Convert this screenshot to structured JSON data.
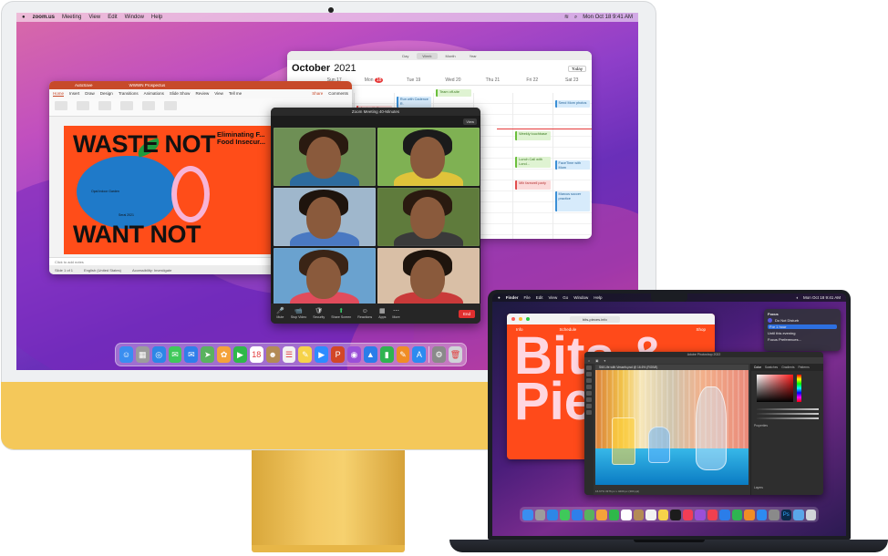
{
  "imac": {
    "menubar": {
      "app": "zoom.us",
      "items": [
        "Meeting",
        "View",
        "Edit",
        "Window",
        "Help"
      ],
      "clock": "Mon Oct 18  9:41 AM"
    },
    "calendar": {
      "tabs": [
        "Day",
        "Week",
        "Month",
        "Year"
      ],
      "selected_tab": "Week",
      "month": "October",
      "year": "2021",
      "today_button": "Today",
      "days": [
        {
          "name": "Sun",
          "num": "17"
        },
        {
          "name": "Mon",
          "num": "18"
        },
        {
          "name": "Tue",
          "num": "19"
        },
        {
          "name": "Wed",
          "num": "20"
        },
        {
          "name": "Thu",
          "num": "21"
        },
        {
          "name": "Fri",
          "num": "22"
        },
        {
          "name": "Sat",
          "num": "23"
        }
      ],
      "events": [
        {
          "text": "Appt. with Dr. Evans"
        },
        {
          "text": "Run with Cadence R."
        },
        {
          "text": "Team off-site"
        },
        {
          "text": "Breakfast + retro"
        },
        {
          "text": "Weekly touchbase"
        },
        {
          "text": "Send Mom photos"
        },
        {
          "text": "Lunch Call with Lond..."
        },
        {
          "text": "FaceTime with Mom"
        },
        {
          "text": "Mih farewell party"
        },
        {
          "text": "Marcus soccer practice"
        }
      ]
    },
    "powerpoint": {
      "autosave": "AutoSave",
      "filename": "WWWN Prospectus",
      "tabs": [
        "Home",
        "Insert",
        "Draw",
        "Design",
        "Transitions",
        "Animations",
        "Slide Show",
        "Review",
        "View",
        "Tell me"
      ],
      "share": "Share",
      "comments": "Comments",
      "slide": {
        "line1": "WASTE NOT",
        "line2": "WANT NOT",
        "heading": "Eliminating F... Food Insecur...",
        "blob_label": "Opal Indoor Garden",
        "blob_label2": "Serai 2021"
      },
      "notes": "Click to add notes",
      "status_slide": "Slide 1 of 1",
      "status_lang": "English (United States)",
      "status_access": "Accessibility: Investigate",
      "status_notes": "Notes",
      "status_comments": "Comments"
    },
    "zoom": {
      "title": "Zoom Meeting  40-Minutes",
      "view_button": "View",
      "tiles": [
        {
          "bg": "#6e8f55",
          "shirt": "#2d6b9e",
          "hair": "#2a1a10"
        },
        {
          "bg": "#7fb153",
          "shirt": "#e0c33a",
          "hair": "#1b1b1b"
        },
        {
          "bg": "#9fb7cc",
          "shirt": "#4a79c2",
          "hair": "#1e140d"
        },
        {
          "bg": "#5f7b3c",
          "shirt": "#3a3a3a",
          "hair": "#2a1a10"
        },
        {
          "bg": "#6aa2cf",
          "shirt": "#e14c5c",
          "hair": "#3a2416"
        },
        {
          "bg": "#d9bfa6",
          "shirt": "#c93a3a",
          "hair": "#1e140d"
        }
      ],
      "toolbar": [
        {
          "icon": "🎤",
          "label": "Mute"
        },
        {
          "icon": "📹",
          "label": "Stop Video"
        },
        {
          "icon": "🛡",
          "label": "Security"
        },
        {
          "icon": "⬆",
          "label": "Share Screen"
        },
        {
          "icon": "☺",
          "label": "Reactions"
        },
        {
          "icon": "▦",
          "label": "Apps"
        },
        {
          "icon": "⋯",
          "label": "More"
        }
      ],
      "end": "End"
    },
    "dock": [
      {
        "name": "finder",
        "color": "#3a8ef0",
        "glyph": "☺"
      },
      {
        "name": "launchpad",
        "color": "#9c9c9c",
        "glyph": "▦"
      },
      {
        "name": "safari",
        "color": "#2d87e6",
        "glyph": "◎"
      },
      {
        "name": "messages",
        "color": "#3fc95a",
        "glyph": "✉"
      },
      {
        "name": "mail",
        "color": "#2f7fea",
        "glyph": "✉"
      },
      {
        "name": "maps",
        "color": "#59b25f",
        "glyph": "➤"
      },
      {
        "name": "photos",
        "color": "#f4a23a",
        "glyph": "✿"
      },
      {
        "name": "facetime",
        "color": "#2fb84a",
        "glyph": "▶"
      },
      {
        "name": "calendar",
        "color": "#ffffff",
        "glyph": "18"
      },
      {
        "name": "contacts",
        "color": "#b38b55",
        "glyph": "☻"
      },
      {
        "name": "reminders",
        "color": "#f2f2f2",
        "glyph": "☰"
      },
      {
        "name": "notes",
        "color": "#f6d34a",
        "glyph": "✎"
      },
      {
        "name": "zoom",
        "color": "#2d8cff",
        "glyph": "▶"
      },
      {
        "name": "powerpoint",
        "color": "#d24726",
        "glyph": "P"
      },
      {
        "name": "podcasts",
        "color": "#9a4fd8",
        "glyph": "◉"
      },
      {
        "name": "keynote",
        "color": "#2b7de9",
        "glyph": "▲"
      },
      {
        "name": "numbers",
        "color": "#2fb451",
        "glyph": "▮"
      },
      {
        "name": "pages",
        "color": "#f08d25",
        "glyph": "✎"
      },
      {
        "name": "app-store",
        "color": "#2d8bf0",
        "glyph": "A"
      },
      {
        "name": "system-preferences",
        "color": "#8a8a8a",
        "glyph": "⚙"
      },
      {
        "name": "trash",
        "color": "#d0d4d8",
        "glyph": "🗑"
      }
    ]
  },
  "macbook": {
    "menubar": {
      "app": "Finder",
      "items": [
        "File",
        "Edit",
        "View",
        "Go",
        "Window",
        "Help"
      ],
      "clock": "Mon Oct 18  9:41 AM"
    },
    "safari": {
      "url": "bits-pieces.info",
      "nav_left": "Info",
      "nav_mid": "Schedule",
      "nav_right": "Shop",
      "big_text": "Bits & Pie"
    },
    "focus": {
      "title": "Focus",
      "subtitle": "Do Not Disturb",
      "options": [
        "For 1 hour",
        "Until this evening"
      ],
      "footer": "Focus Preferences..."
    },
    "photoshop": {
      "title": "Adobe Photoshop 2022",
      "doc_tab": "Still Life with Vessels.psd @ 16.6% (RGB/8)",
      "panel_tabs": [
        "Color",
        "Swatches",
        "Gradients",
        "Patterns"
      ],
      "properties": "Properties",
      "layers": "Layers",
      "status": "16.67%   3376 px x 4200 px (300 ppi)"
    },
    "dock": [
      {
        "name": "finder",
        "color": "#3a8ef0"
      },
      {
        "name": "launchpad",
        "color": "#9c9c9c"
      },
      {
        "name": "safari",
        "color": "#2d87e6"
      },
      {
        "name": "messages",
        "color": "#3fc95a"
      },
      {
        "name": "mail",
        "color": "#2f7fea"
      },
      {
        "name": "maps",
        "color": "#59b25f"
      },
      {
        "name": "photos",
        "color": "#f4a23a"
      },
      {
        "name": "facetime",
        "color": "#2fb84a"
      },
      {
        "name": "calendar",
        "color": "#ffffff"
      },
      {
        "name": "contacts",
        "color": "#b38b55"
      },
      {
        "name": "reminders",
        "color": "#f2f2f2"
      },
      {
        "name": "notes",
        "color": "#f6d34a"
      },
      {
        "name": "tv",
        "color": "#1c1c1c"
      },
      {
        "name": "music",
        "color": "#f23d56"
      },
      {
        "name": "podcasts",
        "color": "#9a4fd8"
      },
      {
        "name": "news",
        "color": "#f0404f"
      },
      {
        "name": "keynote",
        "color": "#2b7de9"
      },
      {
        "name": "numbers",
        "color": "#2fb451"
      },
      {
        "name": "pages",
        "color": "#f08d25"
      },
      {
        "name": "app-store",
        "color": "#2d8bf0"
      },
      {
        "name": "system-preferences",
        "color": "#8a8a8a"
      },
      {
        "name": "photoshop",
        "color": "#0b2a4a",
        "glyph": "Ps"
      },
      {
        "name": "downloads",
        "color": "#5aa6e8"
      },
      {
        "name": "trash",
        "color": "#d0d4d8"
      }
    ]
  }
}
